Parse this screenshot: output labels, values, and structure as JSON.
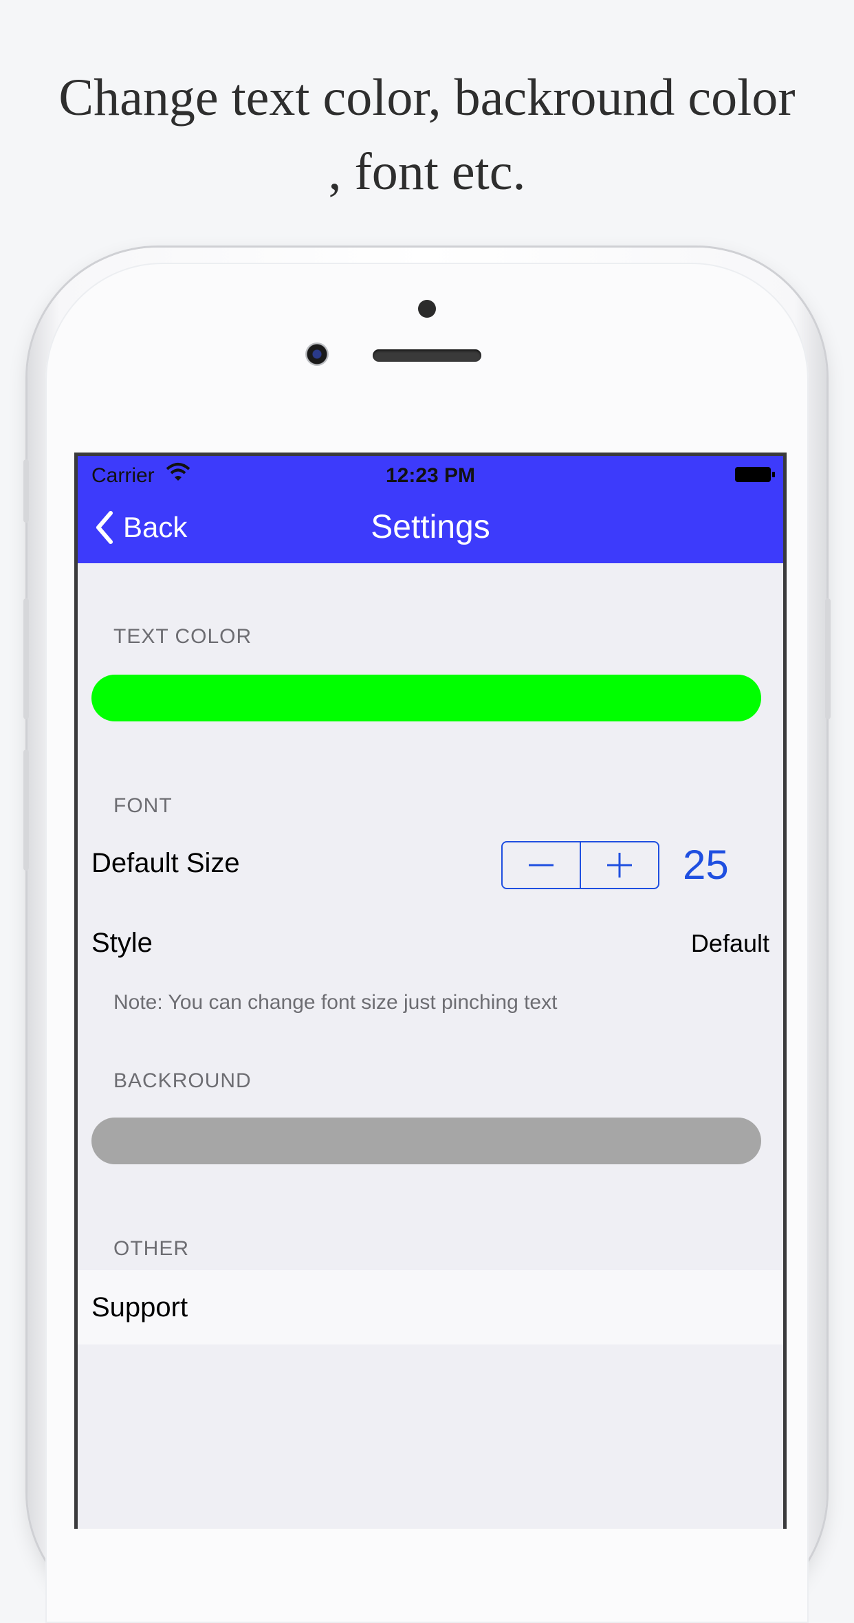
{
  "headline": {
    "line1": "Change text color, backround color",
    "line2": ", font  etc."
  },
  "status_bar": {
    "carrier": "Carrier",
    "time": "12:23 PM"
  },
  "nav": {
    "back_label": "Back",
    "title": "Settings"
  },
  "sections": {
    "text_color": {
      "header": "TEXT COLOR",
      "swatch_color": "#00ff00"
    },
    "font": {
      "header": "FONT",
      "default_size_label": "Default Size",
      "size_value": "25",
      "style_label": "Style",
      "style_value": "Default",
      "note": "Note: You can change font size just pinching text"
    },
    "background": {
      "header": "BACKROUND",
      "swatch_color": "#a6a6a6"
    },
    "other": {
      "header": "OTHER",
      "support_label": "Support"
    }
  },
  "colors": {
    "nav_bar": "#3d3bfb",
    "accent": "#1f4fe0"
  },
  "icons": [
    "wifi-icon",
    "battery-icon",
    "chevron-left-icon",
    "minus-icon",
    "plus-icon"
  ]
}
